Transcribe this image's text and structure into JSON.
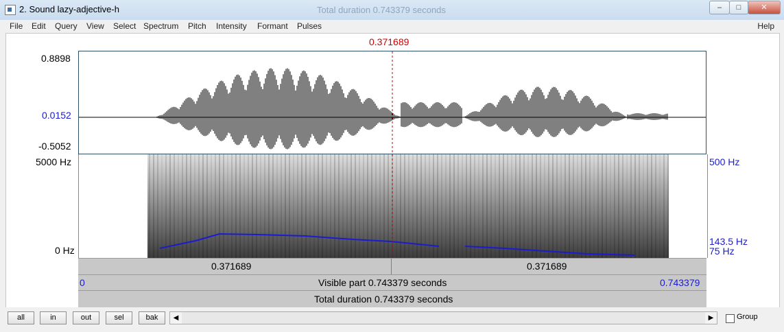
{
  "window": {
    "title": "2. Sound lazy-adjective-h",
    "faded_title": "Total duration 0.743379 seconds",
    "buttons": [
      "–",
      "□",
      "✕"
    ]
  },
  "menu": [
    "File",
    "Edit",
    "Query",
    "View",
    "Select",
    "Spectrum",
    "Pitch",
    "Intensity",
    "Formant",
    "Pulses"
  ],
  "help": "Help",
  "cursor_time": "0.371689",
  "waveform": {
    "y_max": "0.8898",
    "y_zero": "0.0152",
    "y_min": "-0.5052"
  },
  "spectrogram": {
    "freq_top": "5000 Hz",
    "freq_bottom": "0 Hz",
    "pitch_top": "500 Hz",
    "pitch_mark": "143.5 Hz",
    "pitch_bottom": "75 Hz"
  },
  "time_bar": {
    "left_interval": "0.371689",
    "right_interval": "0.371689"
  },
  "visible_bar": {
    "start": "0",
    "text": "Visible part 0.743379 seconds",
    "end": "0.743379"
  },
  "total_bar": {
    "text": "Total duration 0.743379 seconds"
  },
  "controls": {
    "all": "all",
    "in": "in",
    "out": "out",
    "sel": "sel",
    "bak": "bak",
    "group": "Group"
  },
  "colors": {
    "cursor": "#d00000",
    "pitch_curve": "#1b1bd0"
  }
}
